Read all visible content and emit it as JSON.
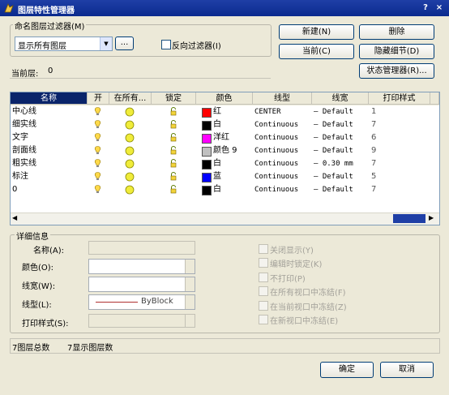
{
  "window": {
    "title": "图层特性管理器",
    "help": "?",
    "close": "×"
  },
  "filter_group": {
    "legend": "命名图层过滤器(M)",
    "combo_value": "显示所有图层",
    "browse_label": "...",
    "invert_label": "反向过滤器(I)"
  },
  "buttons": {
    "new": "新建(N)",
    "delete": "删除",
    "current": "当前(C)",
    "hide_details": "隐藏细节(D)",
    "state_manager": "状态管理器(R)...",
    "ok": "确定",
    "cancel": "取消"
  },
  "current_layer": {
    "label": "当前层:",
    "value": "0"
  },
  "table": {
    "columns": [
      "名称",
      "开",
      "在所有...",
      "锁定",
      "颜色",
      "线型",
      "线宽",
      "打印样式"
    ],
    "rows": [
      {
        "name": "中心线",
        "color_name": "红",
        "color_hex": "#ff0000",
        "linetype": "CENTER",
        "lineweight": "— Default",
        "plot": "1"
      },
      {
        "name": "细实线",
        "color_name": "白",
        "color_hex": "#000000",
        "linetype": "Continuous",
        "lineweight": "— Default",
        "plot": "7"
      },
      {
        "name": "文字",
        "color_name": "洋红",
        "color_hex": "#ff00ff",
        "linetype": "Continuous",
        "lineweight": "— Default",
        "plot": "6"
      },
      {
        "name": "剖面线",
        "color_name": "颜色 9",
        "color_hex": "#c0c0c0",
        "linetype": "Continuous",
        "lineweight": "— Default",
        "plot": "9"
      },
      {
        "name": "粗实线",
        "color_name": "白",
        "color_hex": "#000000",
        "linetype": "Continuous",
        "lineweight": "— 0.30 mm",
        "plot": "7"
      },
      {
        "name": "标注",
        "color_name": "蓝",
        "color_hex": "#0000ff",
        "linetype": "Continuous",
        "lineweight": "— Default",
        "plot": "5"
      },
      {
        "name": "0",
        "color_name": "白",
        "color_hex": "#000000",
        "linetype": "Continuous",
        "lineweight": "— Default",
        "plot": "7"
      }
    ]
  },
  "details": {
    "legend": "详细信息",
    "name_label": "名称(A):",
    "color_label": "颜色(O):",
    "lineweight_label": "线宽(W):",
    "linetype_label": "线型(L):",
    "linetype_value": "ByBlock",
    "plotstyle_label": "打印样式(S):",
    "options": [
      "关闭显示(Y)",
      "编辑时锁定(K)",
      "不打印(P)",
      "在所有视口中冻结(F)",
      "在当前视口中冻结(Z)",
      "在新视口中冻结(E)"
    ]
  },
  "status": {
    "total": "7图层总数",
    "shown": "7显示图层数"
  }
}
